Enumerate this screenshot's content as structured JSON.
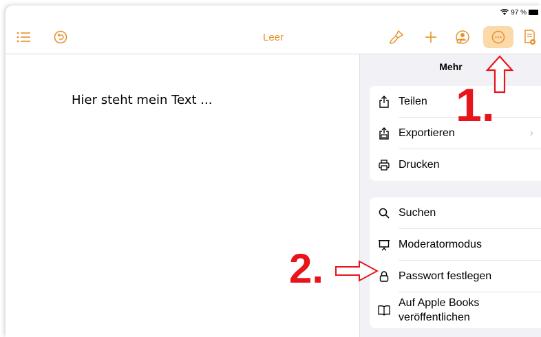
{
  "status": {
    "battery": "97 %"
  },
  "toolbar": {
    "title": "Leer"
  },
  "document": {
    "text": "Hier steht mein Text ..."
  },
  "panel": {
    "title": "Mehr",
    "group1": [
      {
        "label": "Teilen",
        "icon": "share-icon"
      },
      {
        "label": "Exportieren",
        "icon": "export-icon"
      },
      {
        "label": "Drucken",
        "icon": "print-icon"
      }
    ],
    "group2": [
      {
        "label": "Suchen",
        "icon": "search-icon"
      },
      {
        "label": "Moderatormodus",
        "icon": "presenter-icon"
      },
      {
        "label": "Passwort festlegen",
        "icon": "lock-icon"
      },
      {
        "label": "Auf Apple Books",
        "label2": "veröffentlichen",
        "icon": "book-icon"
      }
    ]
  },
  "annotations": {
    "step1": "1.",
    "step2": "2."
  },
  "colors": {
    "accent": "#e8912b",
    "annotation": "#e8141c"
  }
}
